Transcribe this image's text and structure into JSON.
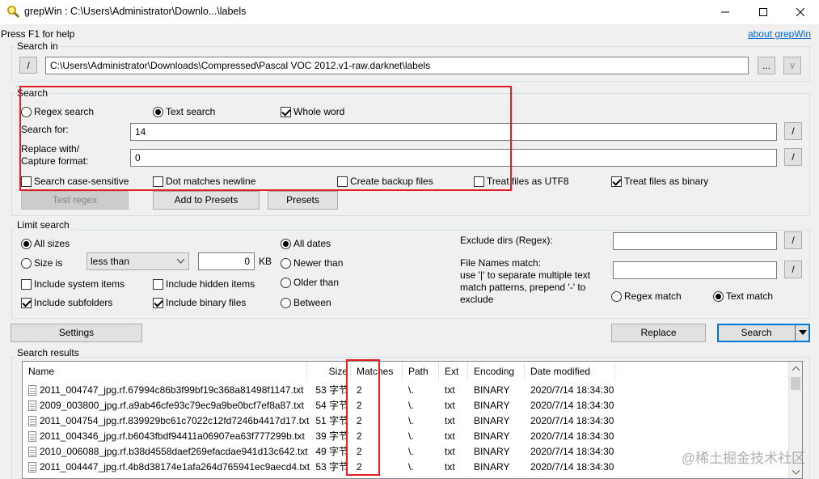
{
  "window": {
    "title": "grepWin : C:\\Users\\Administrator\\Downlo...\\labels",
    "minimize_icon": "minimize-icon",
    "maximize_icon": "maximize-icon",
    "close_icon": "close-icon"
  },
  "help_text": "Press F1 for help",
  "about_link": "about grepWin",
  "search_in": {
    "label": "Search in",
    "toggle_btn": "/",
    "path": "C:\\Users\\Administrator\\Downloads\\Compressed\\Pascal VOC 2012.v1-raw.darknet\\labels",
    "browse_btn": "...",
    "history_btn": "∨"
  },
  "search": {
    "label": "Search",
    "regex_label": "Regex search",
    "text_label": "Text search",
    "whole_word_label": "Whole word",
    "search_for_label": "Search for:",
    "search_for_value": "14",
    "replace_label_1": "Replace with/",
    "replace_label_2": "Capture format:",
    "replace_value": "0",
    "edit_btn": "/",
    "case_label": "Search case-sensitive",
    "dot_label": "Dot matches newline",
    "backup_label": "Create backup files",
    "utf8_label": "Treat files as UTF8",
    "binary_label": "Treat files as binary",
    "test_regex_btn": "Test regex",
    "add_presets_btn": "Add to Presets",
    "presets_btn": "Presets"
  },
  "limit": {
    "label": "Limit search",
    "all_sizes": "All sizes",
    "size_is": "Size is",
    "size_op": "less than",
    "size_value": "0",
    "size_unit": "KB",
    "all_dates": "All dates",
    "newer_than": "Newer than",
    "older_than": "Older than",
    "between": "Between",
    "system_items": "Include system items",
    "hidden_items": "Include hidden items",
    "subfolders": "Include subfolders",
    "binary_files": "Include binary files",
    "exclude_dirs_label": "Exclude dirs (Regex):",
    "exclude_dirs_value": "",
    "file_names_label_1": "File Names match:",
    "file_names_label_2": "use '|' to separate multiple text",
    "file_names_label_3": "match patterns, prepend '-' to",
    "file_names_label_4": "exclude",
    "file_names_value": "",
    "regex_match": "Regex match",
    "text_match": "Text match",
    "edit_btn": "/"
  },
  "actions": {
    "settings": "Settings",
    "replace": "Replace",
    "search": "Search"
  },
  "results": {
    "label": "Search results",
    "columns": [
      "Name",
      "Size",
      "Matches",
      "Path",
      "Ext",
      "Encoding",
      "Date modified"
    ],
    "rows": [
      [
        "2011_004747_jpg.rf.67994c86b3f99bf19c368a81498f1147.txt",
        "53 字节",
        "2",
        "\\.",
        "txt",
        "BINARY",
        "2020/7/14 18:34:30"
      ],
      [
        "2009_003800_jpg.rf.a9ab46cfe93c79ec9a9be0bcf7ef8a87.txt",
        "54 字节",
        "2",
        "\\.",
        "txt",
        "BINARY",
        "2020/7/14 18:34:30"
      ],
      [
        "2011_004754_jpg.rf.839929bc61c7022c12fd7246b4417d17.txt",
        "51 字节",
        "2",
        "\\.",
        "txt",
        "BINARY",
        "2020/7/14 18:34:30"
      ],
      [
        "2011_004346_jpg.rf.b6043fbdf94411a06907ea63f777299b.txt",
        "39 字节",
        "2",
        "\\.",
        "txt",
        "BINARY",
        "2020/7/14 18:34:30"
      ],
      [
        "2010_006088_jpg.rf.b38d4558daef269efacdae941d13c642.txt",
        "49 字节",
        "2",
        "\\.",
        "txt",
        "BINARY",
        "2020/7/14 18:34:30"
      ],
      [
        "2011_004447_jpg.rf.4b8d38174e1afa264d765941ec9aecd4.txt",
        "53 字节",
        "2",
        "\\.",
        "txt",
        "BINARY",
        "2020/7/14 18:34:30"
      ]
    ]
  },
  "watermark": "@稀土掘金技术社区",
  "colors": {
    "highlight": "#e02020",
    "link": "#0066cc",
    "accent": "#0078d7"
  }
}
